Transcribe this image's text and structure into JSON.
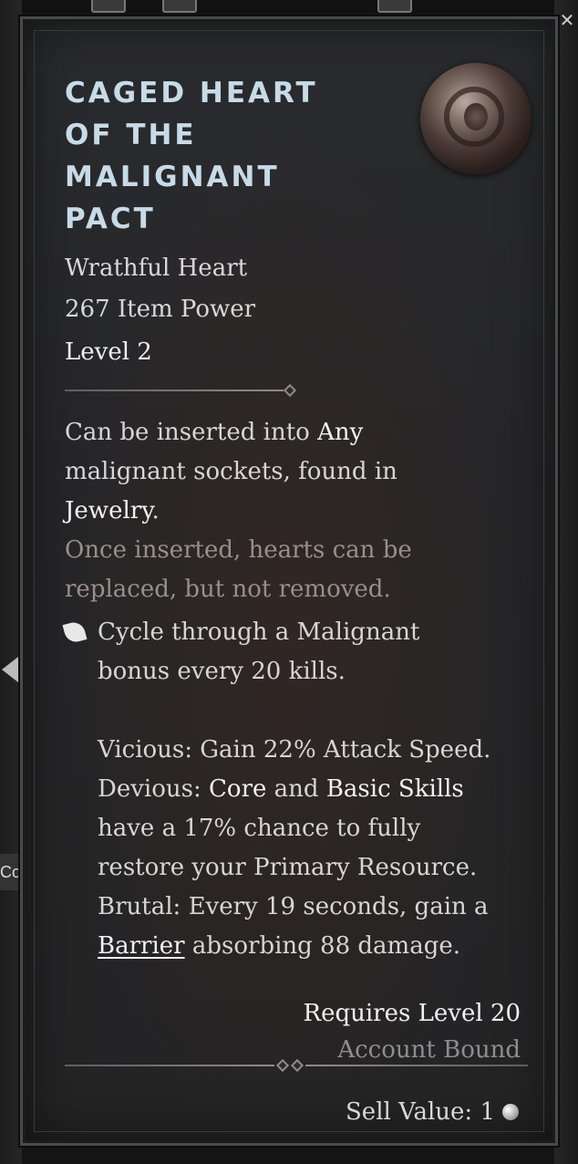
{
  "item": {
    "name": "Caged Heart of the Malignant Pact",
    "name_lines": [
      "CAGED HEART",
      "OF THE",
      "MALIGNANT",
      "PACT"
    ],
    "type": "Wrathful Heart",
    "item_power": "267 Item Power",
    "level": "Level 2"
  },
  "description": {
    "socket_pre": "Can be inserted into ",
    "socket_any": "Any",
    "socket_mid": " malignant sockets, found in",
    "socket_jewelry": "Jewelry",
    "socket_end": ".",
    "warning_line1": "Once inserted, hearts can be",
    "warning_line2": "replaced, but not removed.",
    "bullet_line1": "Cycle through a Malignant",
    "bullet_line2": "bonus every 20 kills.",
    "vicious": "Vicious: Gain 22% Attack Speed.",
    "devious_pre": "Devious: ",
    "devious_core": "Core",
    "devious_and": " and ",
    "devious_basic": "Basic Skills",
    "devious_line2": "have a 17% chance to fully",
    "devious_line3": "restore your Primary Resource.",
    "brutal_line1": "Brutal: Every 19 seconds, gain a",
    "brutal_barrier": "Barrier",
    "brutal_rest": " absorbing 88 damage."
  },
  "requirements": {
    "level": "Requires Level 20",
    "binding": "Account Bound"
  },
  "sell": {
    "label": "Sell Value: 1"
  },
  "background": {
    "side_label": "Co",
    "close_glyph": "✕"
  },
  "colors": {
    "title": "#c7dbe7",
    "warning": "#9a8f88",
    "bound": "#8e8e8e"
  }
}
